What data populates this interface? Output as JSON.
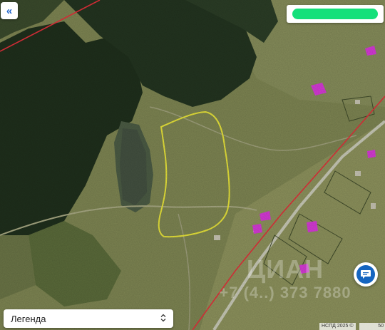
{
  "map": {
    "layer": "satellite",
    "colors": {
      "base": "#6f7a4a",
      "forest": "#1e2e1a",
      "meadow": "#8a8f5e",
      "water": "#4c5a45",
      "plot_outline": "#e6e23a",
      "boundary_line": "#e0303a",
      "parcel_highlight": "#d43ad4",
      "road": "#c9c9b8"
    }
  },
  "controls": {
    "collapse_icon": "double-chevron-left-icon",
    "collapse_glyph": "«",
    "chat_icon": "chat-bubble-icon"
  },
  "legend": {
    "label": "Легенда",
    "chevron_glyph": "⌃⌄"
  },
  "watermark": {
    "brand": "ЦИАН",
    "phone": "+7 (4..) 373 7880"
  },
  "attribution": "НСПД 2025 ©",
  "scale_label": "50"
}
